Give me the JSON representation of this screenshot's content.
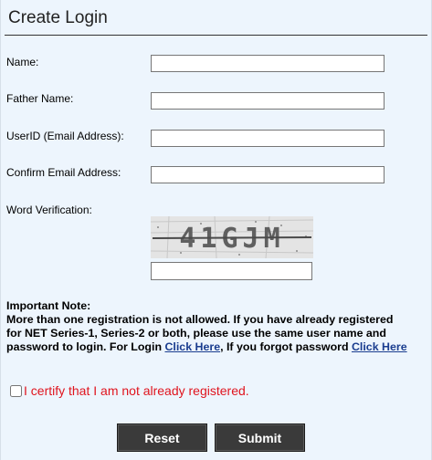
{
  "form": {
    "title": "Create Login",
    "fields": {
      "name_label": "Name:",
      "father_label": "Father Name:",
      "userid_label": "UserID (Email Address):",
      "confirm_label": "Confirm Email Address:",
      "word_label": "Word Verification:",
      "name_value": "",
      "father_value": "",
      "userid_value": "",
      "confirm_value": "",
      "word_value": ""
    },
    "captcha_text": "41GJM",
    "note": {
      "heading": "Important Note:",
      "body_1": "More than one registration is not allowed. If you have already registered for NET Series-1, Series-2 or both, please use the same user name and password to login. For Login ",
      "login_link": "Click Here",
      "body_2": ", If you forgot password ",
      "forgot_link": "Click Here"
    },
    "certify_label": "I certify that I am not already registered.",
    "certify_checked": false,
    "reset_label": "Reset",
    "submit_label": "Submit"
  },
  "colors": {
    "panel_bg": "#edf5fd",
    "button_bg": "#3a3a3a",
    "certify_text": "#e0141e",
    "link": "#1a3d8f"
  }
}
